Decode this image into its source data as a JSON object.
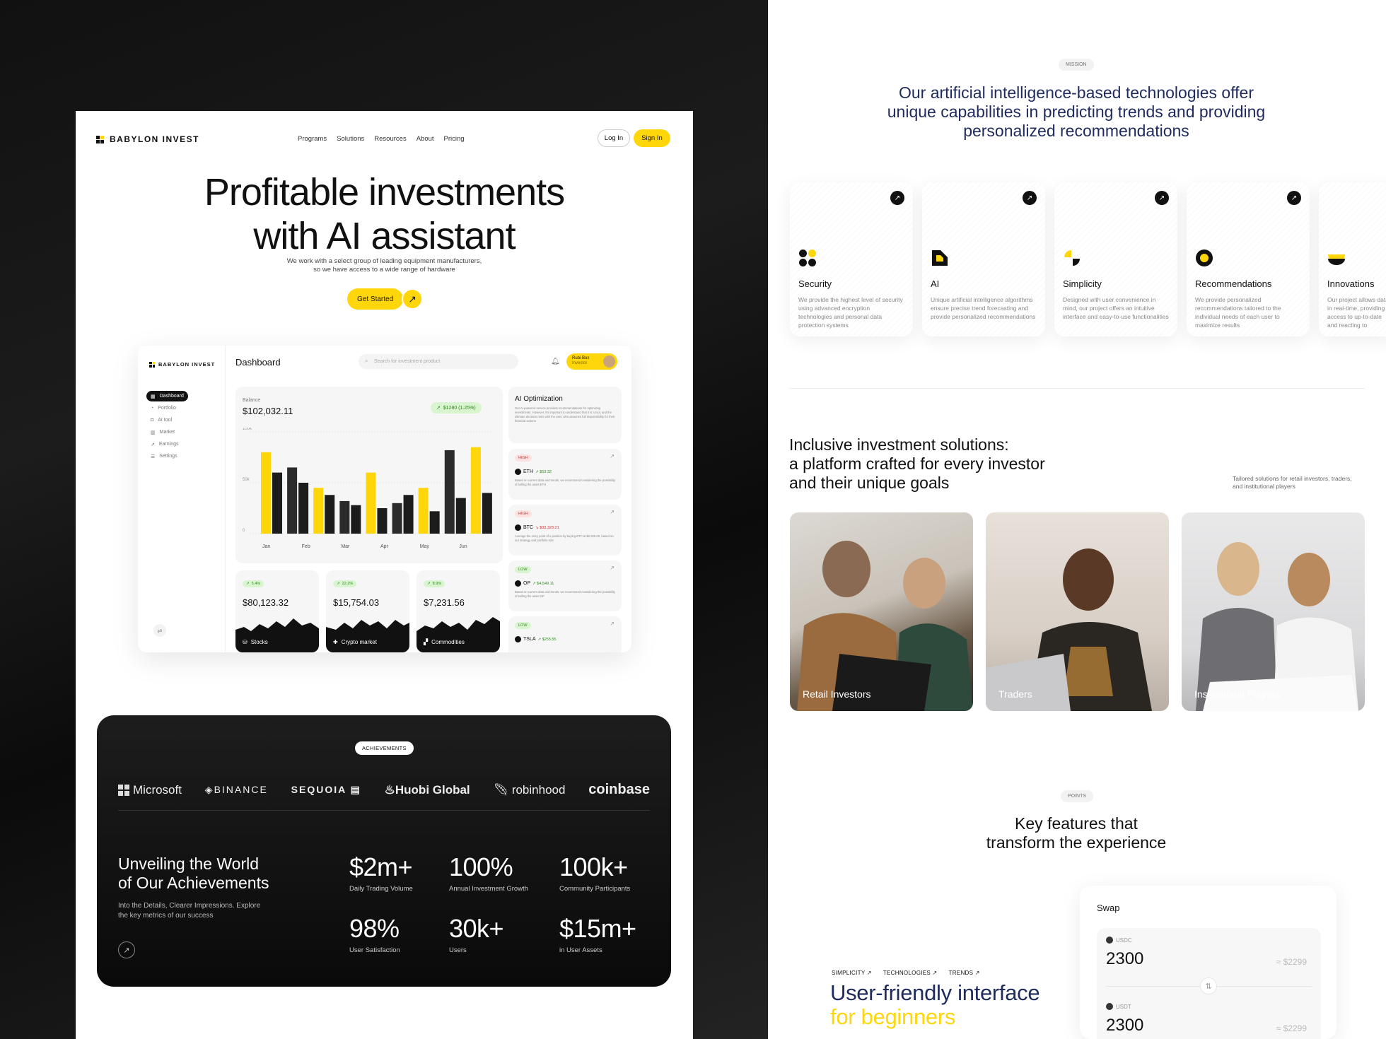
{
  "nav": {
    "brand": "BABYLON INVEST",
    "links": [
      "Programs",
      "Solutions",
      "Resources",
      "About",
      "Pricing"
    ],
    "login": "Log In",
    "signin": "Sign In"
  },
  "hero": {
    "title_line1": "Profitable investments",
    "title_line2": "with AI assistant",
    "sub_line1": "We work with a select group of leading equipment manufacturers,",
    "sub_line2": "so we have access to a wide range of hardware",
    "cta": "Get Started"
  },
  "dashboard": {
    "brand": "BABYLON INVEST",
    "title": "Dashboard",
    "search_placeholder": "Search for investment product",
    "user_name": "Rubi Box",
    "user_role": "Investor",
    "side_items": [
      "Dashboard",
      "Portfolio",
      "AI tool",
      "Market",
      "Earnings",
      "Settings"
    ],
    "balance_label": "Balance",
    "balance_value": "$102,032.11",
    "balance_change": "$1280 (1.25%)",
    "chart_data": {
      "type": "bar",
      "categories": [
        "Jan",
        "Feb",
        "Mar",
        "Apr",
        "May",
        "Jun"
      ],
      "y_ticks": [
        "100k",
        "50k",
        "0"
      ],
      "ylim": [
        0,
        100
      ],
      "series": [
        {
          "values": [
            80,
            65,
            45,
            32,
            60,
            30,
            45,
            82,
            85
          ]
        },
        {
          "values": [
            60,
            50,
            38,
            28,
            25,
            38,
            22,
            35,
            40
          ]
        }
      ]
    },
    "ai": {
      "title": "AI Optimization",
      "text": "Our AI-powered service provides recommendations for optimizing investments. However, it's important to understand that it is a tool, and the ultimate decision rests with the user, who assumes full responsibility for their financial actions"
    },
    "signals": [
      {
        "level": "HIGH",
        "ticker": "ETH",
        "change": "$53.32",
        "dir": "up",
        "text": "Based on current data and trends, we recommend considering the possibility of selling the asset ETH"
      },
      {
        "level": "HIGH",
        "ticker": "BTC",
        "change": "$33,323.21",
        "dir": "down",
        "text": "Average the entry point of a position by buying BTC at $2,325.00, based on our strategy and portfolio size"
      },
      {
        "level": "LOW",
        "ticker": "OP",
        "change": "$4,549.11",
        "dir": "up",
        "text": "Based on current data and trends, we recommend considering the possibility of selling the asset OP"
      },
      {
        "level": "LOW",
        "ticker": "TSLA",
        "change": "$255.55",
        "dir": "up",
        "text": ""
      }
    ],
    "stats": [
      {
        "pct": "5.4%",
        "value": "$80,123.32",
        "label": "Stocks"
      },
      {
        "pct": "22.2%",
        "value": "$15,754.03",
        "label": "Crypto market"
      },
      {
        "pct": "8.9%",
        "value": "$7,231.56",
        "label": "Commodities"
      }
    ]
  },
  "achievements": {
    "pill": "ACHIEVEMENTS",
    "logos": [
      "Microsoft",
      "BINANCE",
      "SEQUOIA",
      "Huobi Global",
      "robinhood",
      "coinbase"
    ],
    "title_line1": "Unveiling the World",
    "title_line2": "of Our Achievements",
    "sub_line1": "Into the Details, Clearer Impressions. Explore",
    "sub_line2": "the key metrics of our success",
    "metrics": [
      {
        "value": "$2m+",
        "label": "Daily Trading Volume"
      },
      {
        "value": "100%",
        "label": "Annual Investment Growth"
      },
      {
        "value": "100k+",
        "label": "Community Participants"
      },
      {
        "value": "98%",
        "label": "User Satisfaction"
      },
      {
        "value": "30k+",
        "label": "Users"
      },
      {
        "value": "$15m+",
        "label": "in User Assets"
      }
    ]
  },
  "mission": {
    "pill": "MISSION",
    "line1": "Our artificial intelligence-based technologies offer",
    "line2": "unique capabilities in predicting trends and providing",
    "line3": "personalized recommendations",
    "features": [
      {
        "title": "Security",
        "desc": "We provide the highest level of security using advanced encryption technologies and personal data protection systems"
      },
      {
        "title": "AI",
        "desc": "Unique artificial intelligence algorithms ensure precise trend forecasting and provide personalized recommendations"
      },
      {
        "title": "Simplicity",
        "desc": "Designed with user convenience in mind, our project offers an intuitive interface and easy-to-use functionalities"
      },
      {
        "title": "Recommendations",
        "desc": "We provide personalized recommendations tailored to the individual needs of each user to maximize results"
      },
      {
        "title": "Innovations",
        "desc": "Our project allows data in real-time, providing access to up-to-date and reacting to changes"
      }
    ]
  },
  "inclusive": {
    "line1": "Inclusive investment solutions:",
    "line2": "a platform crafted for every investor",
    "line3": "and their unique goals",
    "note_line1": "Tailored solutions for retail investors, traders,",
    "note_line2": "and institutional players",
    "photos": [
      "Retail Investors",
      "Traders",
      "Institutional Players"
    ]
  },
  "points": {
    "pill": "POINTS",
    "line1": "Key features that",
    "line2": "transform the experience",
    "tabs": [
      "SIMPLICITY ↗",
      "TECHNOLOGIES ↗",
      "TRENDS ↗"
    ],
    "ufi_line1": "User-friendly interface",
    "ufi_line2": "for beginners"
  },
  "swap": {
    "title": "Swap",
    "from_token": "USDC",
    "from_amount": "2300",
    "from_usd": "≈ $2299",
    "to_token": "USDT",
    "to_amount": "2300",
    "to_usd": "≈ $2299"
  },
  "colors": {
    "accent": "#ffd60a",
    "navy": "#1f2b5c",
    "dark": "#111111"
  }
}
